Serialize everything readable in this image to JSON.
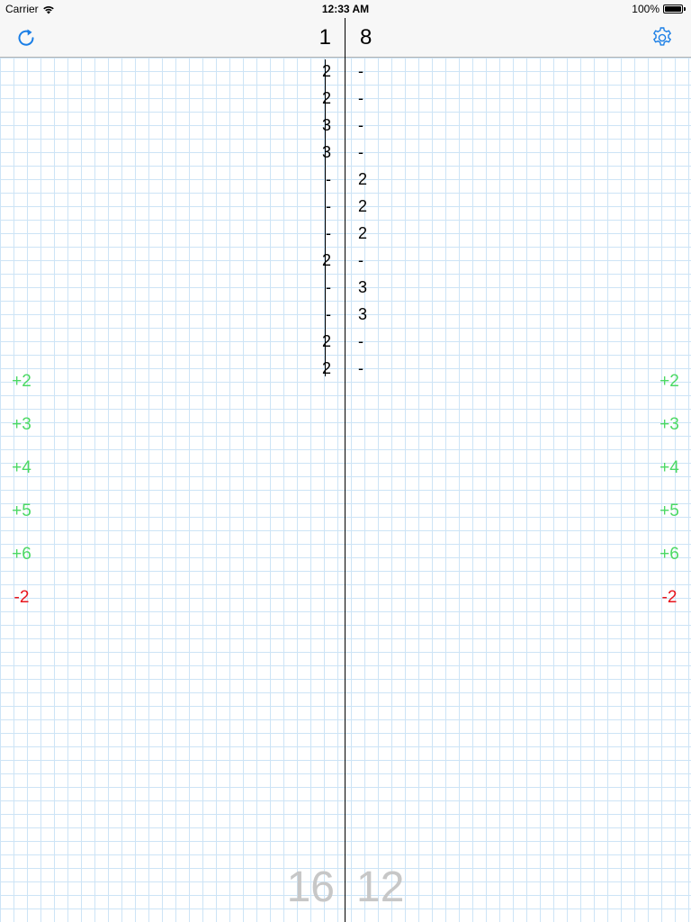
{
  "status_bar": {
    "carrier": "Carrier",
    "time": "12:33 AM",
    "battery": "100%"
  },
  "header": {
    "refresh_icon": "refresh-icon",
    "settings_icon": "gear-icon",
    "left_count": "1",
    "right_count": "8",
    "accent_color": "#1a7ee6"
  },
  "left_entries": [
    "2",
    "2",
    "3",
    "3",
    "-",
    "-",
    "-",
    "2",
    "-",
    "-",
    "2",
    "2"
  ],
  "right_entries": [
    "-",
    "-",
    "-",
    "-",
    "2",
    "2",
    "2",
    "-",
    "3",
    "3",
    "-",
    "-"
  ],
  "left_buttons": [
    "+2",
    "+3",
    "+4",
    "+5",
    "+6",
    "-2"
  ],
  "right_buttons": [
    "+2",
    "+3",
    "+4",
    "+5",
    "+6",
    "-2"
  ],
  "totals": {
    "left": "16",
    "right": "12"
  },
  "colors": {
    "plus": "#4cd964",
    "minus": "#e8141c",
    "grid": "#cde4f6",
    "total": "#c7c7c7"
  }
}
